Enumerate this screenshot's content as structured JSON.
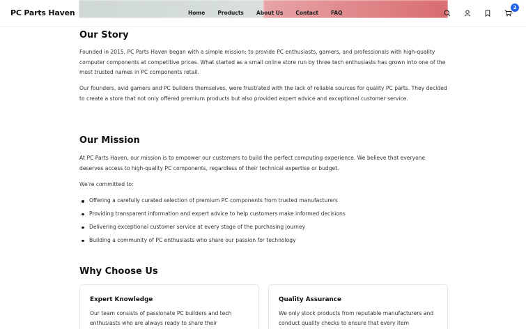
{
  "brand": {
    "logo": "PC Parts Haven"
  },
  "nav": {
    "items": [
      "Home",
      "Products",
      "About Us",
      "Contact",
      "FAQ"
    ]
  },
  "header_icons": {
    "search": "search-icon",
    "account": "user-icon",
    "wishlist": "bookmark-icon",
    "cart": "cart-icon",
    "cart_count": "2"
  },
  "story": {
    "title": "Our Story",
    "p1": "Founded in 2015, PC Parts Haven began with a simple mission: to provide PC enthusiasts, gamers, and professionals with high-quality computer components at competitive prices. What started as a small online store run by three tech enthusiasts has grown into one of the most trusted names in PC components retail.",
    "p2": "Our founders, avid gamers and PC builders themselves, were frustrated with the lack of reliable sources for quality PC parts. They decided to create a store that not only offered premium products but also provided expert advice and exceptional customer service."
  },
  "mission": {
    "title": "Our Mission",
    "p1": "At PC Parts Haven, our mission is to empower our customers to build the perfect computing experience. We believe that everyone deserves access to high-quality PC components, regardless of their technical expertise or budget.",
    "p2": "We're committed to:",
    "list": [
      "Offering a carefully curated selection of premium PC components from trusted manufacturers",
      "Providing transparent information and expert advice to help customers make informed decisions",
      "Delivering exceptional customer service at every stage of the purchasing journey",
      "Building a community of PC enthusiasts who share our passion for technology"
    ]
  },
  "why": {
    "title": "Why Choose Us",
    "cards": [
      {
        "title": "Expert Knowledge",
        "text": "Our team consists of passionate PC builders and tech enthusiasts who are always ready to share their"
      },
      {
        "title": "Quality Assurance",
        "text": "We only stock products from reputable manufacturers and conduct quality checks to ensure that every item"
      }
    ]
  }
}
